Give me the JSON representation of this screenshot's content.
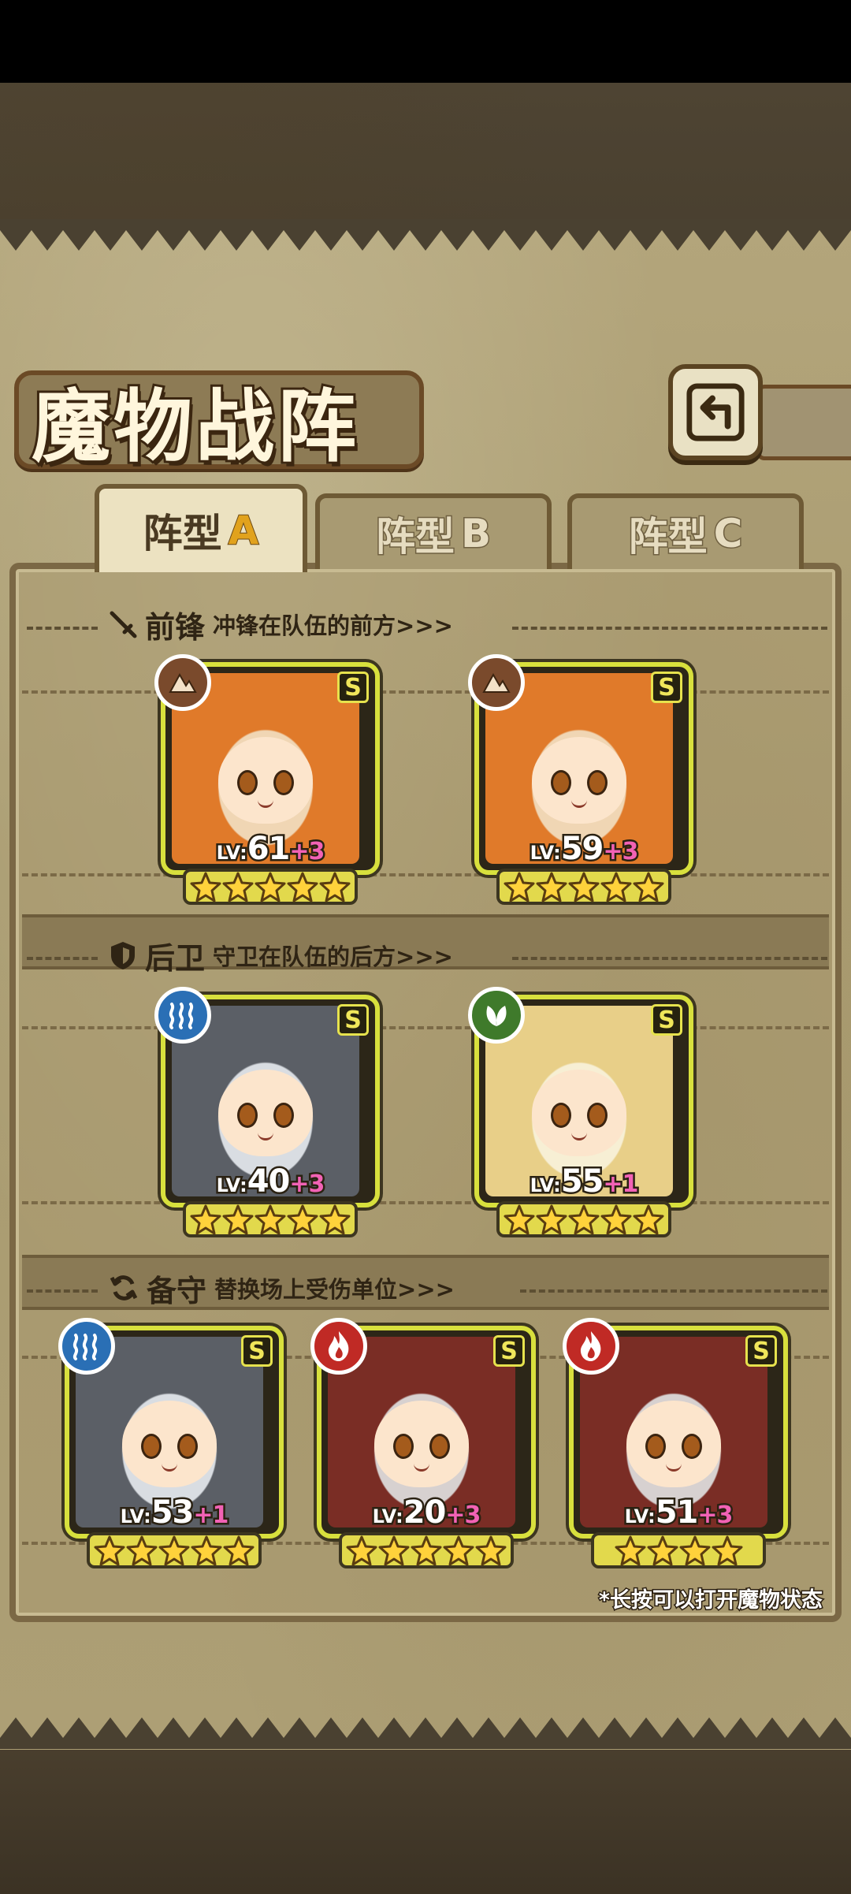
{
  "title": "魔物战阵",
  "back_icon": "return-arrow-icon",
  "tabs": [
    {
      "prefix": "阵型",
      "letter": "A",
      "active": true
    },
    {
      "prefix": "阵型",
      "letter": "B",
      "active": false
    },
    {
      "prefix": "阵型",
      "letter": "C",
      "active": false
    }
  ],
  "sections": [
    {
      "id": "vanguard",
      "name": "前锋",
      "desc": "冲锋在队伍的前方>>>",
      "icon": "sword-icon"
    },
    {
      "id": "rearguard",
      "name": "后卫",
      "desc": "守卫在队伍的后方>>>",
      "icon": "shield-icon"
    },
    {
      "id": "reserve",
      "name": "备守",
      "desc": "替换场上受伤单位>>>",
      "icon": "swap-arrows-icon"
    }
  ],
  "cards": {
    "vanguard": [
      {
        "element": "earth",
        "element_icon": "mountain-icon",
        "rank": "S",
        "lv_prefix": "LV:",
        "level": "61",
        "bonus": "+3",
        "stars": 5
      },
      {
        "element": "earth",
        "element_icon": "mountain-icon",
        "rank": "S",
        "lv_prefix": "LV:",
        "level": "59",
        "bonus": "+3",
        "stars": 5
      }
    ],
    "rearguard": [
      {
        "element": "water",
        "element_icon": "waves-icon",
        "rank": "S",
        "lv_prefix": "LV:",
        "level": "40",
        "bonus": "+3",
        "stars": 5
      },
      {
        "element": "nature",
        "element_icon": "leaf-icon",
        "rank": "S",
        "lv_prefix": "LV:",
        "level": "55",
        "bonus": "+1",
        "stars": 5
      }
    ],
    "reserve": [
      {
        "element": "water",
        "element_icon": "waves-icon",
        "rank": "S",
        "lv_prefix": "LV:",
        "level": "53",
        "bonus": "+1",
        "stars": 5
      },
      {
        "element": "fire",
        "element_icon": "flame-icon",
        "rank": "S",
        "lv_prefix": "LV:",
        "level": "20",
        "bonus": "+3",
        "stars": 5
      },
      {
        "element": "fire",
        "element_icon": "flame-icon",
        "rank": "S",
        "lv_prefix": "LV:",
        "level": "51",
        "bonus": "+3",
        "stars": 4
      }
    ]
  },
  "hint": "*长按可以打开魔物状态",
  "colors": {
    "earth": "#7a4a2c",
    "water": "#2a6fb5",
    "nature": "#3f7a2b",
    "fire": "#c02a25",
    "card_border": "#d8e03d",
    "plus": "#f262b5"
  }
}
